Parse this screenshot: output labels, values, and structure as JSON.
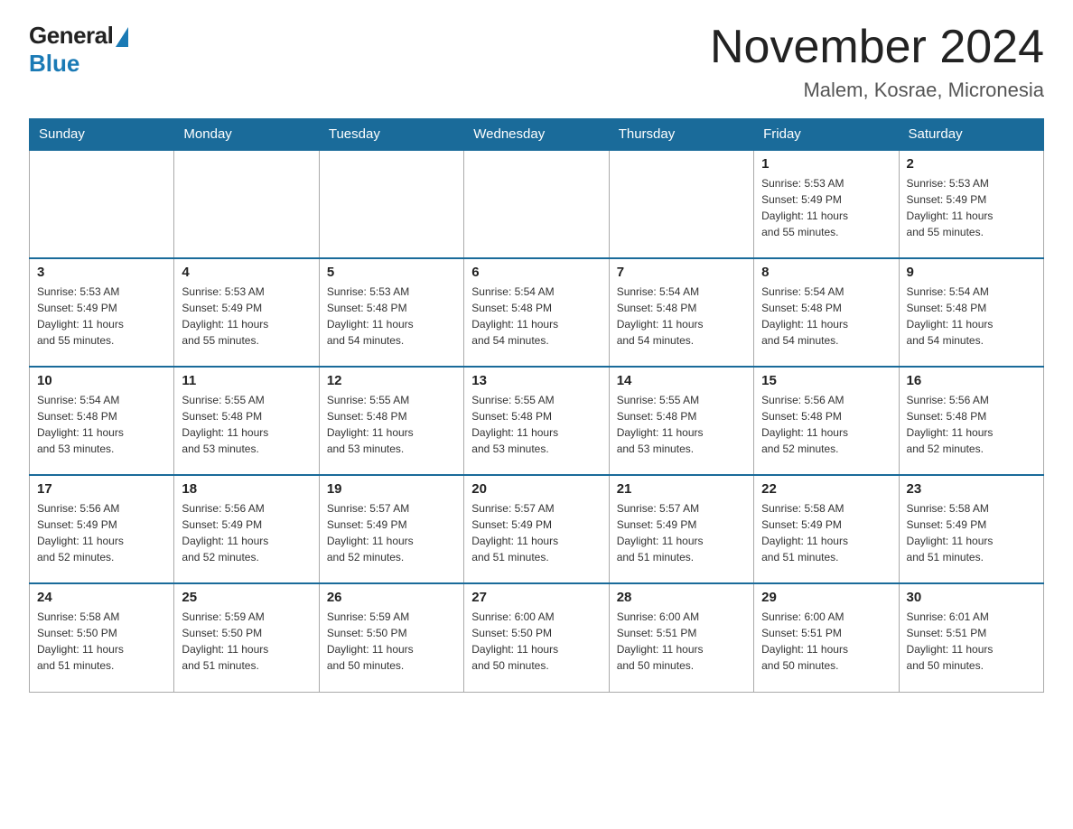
{
  "logo": {
    "general_text": "General",
    "blue_text": "Blue"
  },
  "header": {
    "month_year": "November 2024",
    "location": "Malem, Kosrae, Micronesia"
  },
  "weekdays": [
    "Sunday",
    "Monday",
    "Tuesday",
    "Wednesday",
    "Thursday",
    "Friday",
    "Saturday"
  ],
  "weeks": [
    [
      {
        "day": "",
        "info": ""
      },
      {
        "day": "",
        "info": ""
      },
      {
        "day": "",
        "info": ""
      },
      {
        "day": "",
        "info": ""
      },
      {
        "day": "",
        "info": ""
      },
      {
        "day": "1",
        "info": "Sunrise: 5:53 AM\nSunset: 5:49 PM\nDaylight: 11 hours\nand 55 minutes."
      },
      {
        "day": "2",
        "info": "Sunrise: 5:53 AM\nSunset: 5:49 PM\nDaylight: 11 hours\nand 55 minutes."
      }
    ],
    [
      {
        "day": "3",
        "info": "Sunrise: 5:53 AM\nSunset: 5:49 PM\nDaylight: 11 hours\nand 55 minutes."
      },
      {
        "day": "4",
        "info": "Sunrise: 5:53 AM\nSunset: 5:49 PM\nDaylight: 11 hours\nand 55 minutes."
      },
      {
        "day": "5",
        "info": "Sunrise: 5:53 AM\nSunset: 5:48 PM\nDaylight: 11 hours\nand 54 minutes."
      },
      {
        "day": "6",
        "info": "Sunrise: 5:54 AM\nSunset: 5:48 PM\nDaylight: 11 hours\nand 54 minutes."
      },
      {
        "day": "7",
        "info": "Sunrise: 5:54 AM\nSunset: 5:48 PM\nDaylight: 11 hours\nand 54 minutes."
      },
      {
        "day": "8",
        "info": "Sunrise: 5:54 AM\nSunset: 5:48 PM\nDaylight: 11 hours\nand 54 minutes."
      },
      {
        "day": "9",
        "info": "Sunrise: 5:54 AM\nSunset: 5:48 PM\nDaylight: 11 hours\nand 54 minutes."
      }
    ],
    [
      {
        "day": "10",
        "info": "Sunrise: 5:54 AM\nSunset: 5:48 PM\nDaylight: 11 hours\nand 53 minutes."
      },
      {
        "day": "11",
        "info": "Sunrise: 5:55 AM\nSunset: 5:48 PM\nDaylight: 11 hours\nand 53 minutes."
      },
      {
        "day": "12",
        "info": "Sunrise: 5:55 AM\nSunset: 5:48 PM\nDaylight: 11 hours\nand 53 minutes."
      },
      {
        "day": "13",
        "info": "Sunrise: 5:55 AM\nSunset: 5:48 PM\nDaylight: 11 hours\nand 53 minutes."
      },
      {
        "day": "14",
        "info": "Sunrise: 5:55 AM\nSunset: 5:48 PM\nDaylight: 11 hours\nand 53 minutes."
      },
      {
        "day": "15",
        "info": "Sunrise: 5:56 AM\nSunset: 5:48 PM\nDaylight: 11 hours\nand 52 minutes."
      },
      {
        "day": "16",
        "info": "Sunrise: 5:56 AM\nSunset: 5:48 PM\nDaylight: 11 hours\nand 52 minutes."
      }
    ],
    [
      {
        "day": "17",
        "info": "Sunrise: 5:56 AM\nSunset: 5:49 PM\nDaylight: 11 hours\nand 52 minutes."
      },
      {
        "day": "18",
        "info": "Sunrise: 5:56 AM\nSunset: 5:49 PM\nDaylight: 11 hours\nand 52 minutes."
      },
      {
        "day": "19",
        "info": "Sunrise: 5:57 AM\nSunset: 5:49 PM\nDaylight: 11 hours\nand 52 minutes."
      },
      {
        "day": "20",
        "info": "Sunrise: 5:57 AM\nSunset: 5:49 PM\nDaylight: 11 hours\nand 51 minutes."
      },
      {
        "day": "21",
        "info": "Sunrise: 5:57 AM\nSunset: 5:49 PM\nDaylight: 11 hours\nand 51 minutes."
      },
      {
        "day": "22",
        "info": "Sunrise: 5:58 AM\nSunset: 5:49 PM\nDaylight: 11 hours\nand 51 minutes."
      },
      {
        "day": "23",
        "info": "Sunrise: 5:58 AM\nSunset: 5:49 PM\nDaylight: 11 hours\nand 51 minutes."
      }
    ],
    [
      {
        "day": "24",
        "info": "Sunrise: 5:58 AM\nSunset: 5:50 PM\nDaylight: 11 hours\nand 51 minutes."
      },
      {
        "day": "25",
        "info": "Sunrise: 5:59 AM\nSunset: 5:50 PM\nDaylight: 11 hours\nand 51 minutes."
      },
      {
        "day": "26",
        "info": "Sunrise: 5:59 AM\nSunset: 5:50 PM\nDaylight: 11 hours\nand 50 minutes."
      },
      {
        "day": "27",
        "info": "Sunrise: 6:00 AM\nSunset: 5:50 PM\nDaylight: 11 hours\nand 50 minutes."
      },
      {
        "day": "28",
        "info": "Sunrise: 6:00 AM\nSunset: 5:51 PM\nDaylight: 11 hours\nand 50 minutes."
      },
      {
        "day": "29",
        "info": "Sunrise: 6:00 AM\nSunset: 5:51 PM\nDaylight: 11 hours\nand 50 minutes."
      },
      {
        "day": "30",
        "info": "Sunrise: 6:01 AM\nSunset: 5:51 PM\nDaylight: 11 hours\nand 50 minutes."
      }
    ]
  ]
}
